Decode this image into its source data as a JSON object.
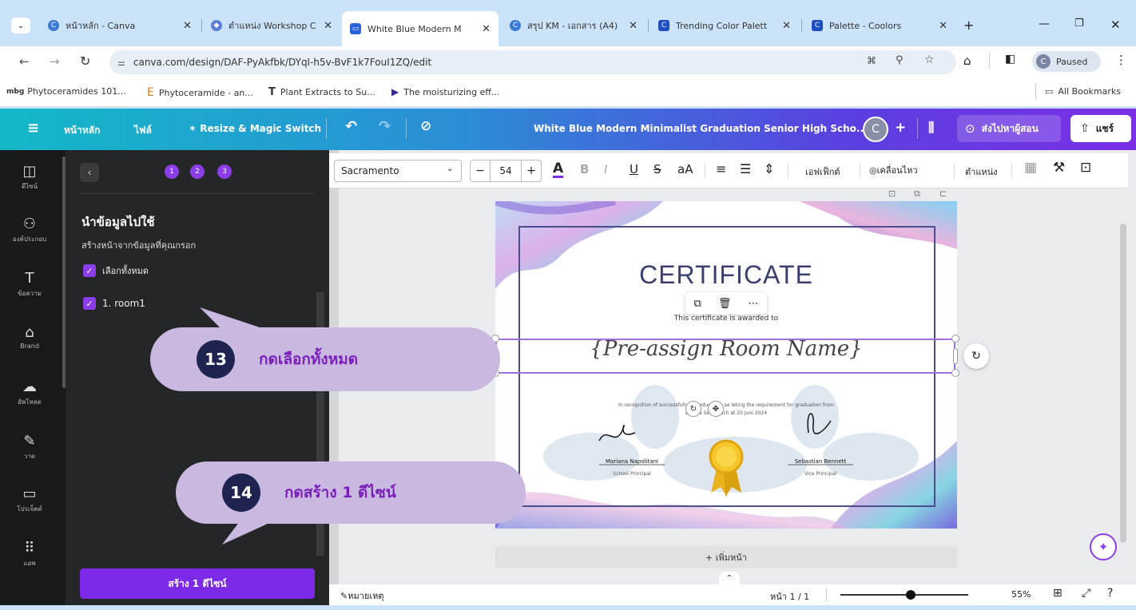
{
  "browser": {
    "tabs": [
      {
        "label": "หน้าหลัก - Canva",
        "icon": "canva-icon"
      },
      {
        "label": "ตำแหน่ง Workshop C",
        "icon": "workshop-icon"
      },
      {
        "label": "White Blue Modern M",
        "icon": "canva-doc-icon",
        "active": true
      },
      {
        "label": "สรุป KM - เอกสาร (A4)",
        "icon": "canva-icon"
      },
      {
        "label": "Trending Color Palett",
        "icon": "coolors-icon"
      },
      {
        "label": "Palette - Coolors",
        "icon": "coolors-icon"
      }
    ],
    "url": "canva.com/design/DAF-PyAkfbk/DYqI-h5v-BvF1k7FouI1ZQ/edit",
    "profile_initial": "C",
    "profile_status": "Paused",
    "bookmarks": [
      {
        "label": "Phytoceramides 101...",
        "icon": "mbg-icon"
      },
      {
        "label": "Phytoceramide - an...",
        "icon": "e-icon"
      },
      {
        "label": "Plant Extracts to Su...",
        "icon": "t-icon"
      },
      {
        "label": "The moisturizing eff...",
        "icon": "arrow-icon"
      }
    ],
    "all_bookmarks": "All Bookmarks"
  },
  "canva_header": {
    "home": "หน้าหลัก",
    "file": "ไฟล์",
    "resize": "Resize & Magic Switch",
    "doc_title": "White Blue Modern Minimalist Graduation Senior High Scho...",
    "avatar": "C",
    "send_teacher": "ส่งไปหาผู้สอน",
    "share": "แชร์"
  },
  "rail": [
    {
      "label": "ดีไซน์",
      "icon": "design-icon",
      "glyph": "◫"
    },
    {
      "label": "องค์ประกอบ",
      "icon": "elements-icon",
      "glyph": "⚇"
    },
    {
      "label": "ข้อความ",
      "icon": "text-icon",
      "glyph": "T"
    },
    {
      "label": "Brand",
      "icon": "brand-icon",
      "glyph": "⌂"
    },
    {
      "label": "อัพโหลด",
      "icon": "upload-icon",
      "glyph": "☁"
    },
    {
      "label": "วาด",
      "icon": "draw-icon",
      "glyph": "✎"
    },
    {
      "label": "โปรเจ็คต์",
      "icon": "projects-icon",
      "glyph": "▭"
    },
    {
      "label": "แอพ",
      "icon": "apps-icon",
      "glyph": "⠿"
    }
  ],
  "panel": {
    "steps": [
      "1",
      "2",
      "3"
    ],
    "heading": "นำข้อมูลไปใช้",
    "subheading": "สร้างหน้าจากข้อมูลที่คุณกรอก",
    "select_all": "เลือกทั้งหมด",
    "rows": [
      "1. room1"
    ],
    "create_button": "สร้าง 1 ดีไซน์"
  },
  "context_toolbar": {
    "font": "Sacramento",
    "size": "54",
    "effects": "เอฟเฟ็กต์",
    "animate": "เคลื่อนไหว",
    "position": "ตำแหน่ง"
  },
  "certificate": {
    "title": "CERTIFICATE",
    "awarded": "This certificate is awarded to",
    "name": "{Pre-assign Room Name}",
    "body_line1": "In recognition of successfully her education  se    leting the requirement for graduation from",
    "body_line2": "Larana Senior     Sch    at 20 Juni 2024",
    "sig1_name": "Mariana Napolitani",
    "sig1_title": "School Principal",
    "sig2_name": "Sebastian Bennett",
    "sig2_title": "Vice Principal"
  },
  "editor": {
    "add_page": "+ เพิ่มหน้า",
    "notes": "หมายเหตุ",
    "page_indicator": "หน้า 1 / 1",
    "zoom": "55%",
    "zoom_fraction": 0.55
  },
  "callouts": [
    {
      "number": "13",
      "text": "กดเลือกทั้งหมด"
    },
    {
      "number": "14",
      "text": "กดสร้าง 1 ดีไซน์"
    }
  ],
  "colors": {
    "accent_purple": "#7d2ae8",
    "callout_bg": "#c9b8df",
    "callout_text": "#7a1fb8",
    "badge": "#1e2350"
  }
}
